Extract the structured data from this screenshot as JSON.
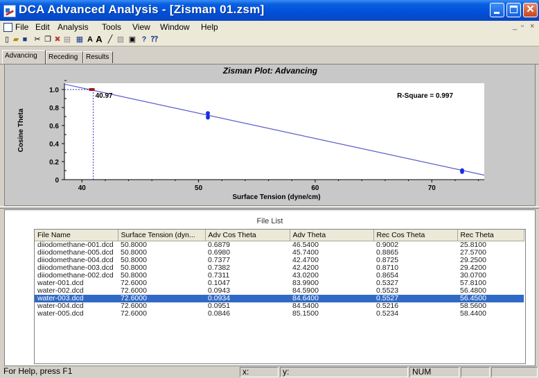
{
  "window": {
    "title": "DCA Advanced Analysis - [Zisman 01.zsm]"
  },
  "menu": [
    "File",
    "Edit",
    "Analysis",
    "Tools",
    "View",
    "Window",
    "Help"
  ],
  "tabs": [
    "Advancing",
    "Receding",
    "Results"
  ],
  "active_tab": "Advancing",
  "chart_data": {
    "type": "scatter",
    "title": "Zisman Plot: Advancing",
    "xlabel": "Surface Tension (dyne/cm)",
    "ylabel": "Cosine Theta",
    "xlim": [
      38.5,
      74.5
    ],
    "ylim": [
      0,
      1.07
    ],
    "xticks": [
      40,
      50,
      60,
      70
    ],
    "yticks": [
      0,
      0.2,
      0.4,
      0.6,
      0.8,
      1.0
    ],
    "ytick_labels": [
      "0",
      "0.2",
      "0.4",
      "0.6",
      "0.8",
      "1.0"
    ],
    "points": [
      {
        "x": 50.8,
        "y": 0.6879
      },
      {
        "x": 50.8,
        "y": 0.698
      },
      {
        "x": 50.8,
        "y": 0.7377
      },
      {
        "x": 50.8,
        "y": 0.7382
      },
      {
        "x": 50.8,
        "y": 0.7311
      },
      {
        "x": 72.6,
        "y": 0.1047
      },
      {
        "x": 72.6,
        "y": 0.0943
      },
      {
        "x": 72.6,
        "y": 0.0934
      },
      {
        "x": 72.6,
        "y": 0.0951
      },
      {
        "x": 72.6,
        "y": 0.0846
      }
    ],
    "fit_line": {
      "x": [
        38.5,
        74.5
      ],
      "y": [
        1.06,
        0.05
      ]
    },
    "critical_point": {
      "x": 40.97,
      "y": 1.0,
      "label": "40.97"
    },
    "annotation": "R-Square = 0.997",
    "colors": {
      "points": "#1c2ee6",
      "line": "#5b5bc8",
      "marker": "#9e1212",
      "guide": "#2828c8"
    },
    "grid": false
  },
  "filelist": {
    "title": "File List",
    "columns": [
      "File Name",
      "Surface Tension (dyn...",
      "Adv Cos Theta",
      "Adv Theta",
      "Rec Cos Theta",
      "Rec Theta"
    ],
    "rows": [
      [
        "diiodomethane-001.dcd",
        "50.8000",
        "0.6879",
        "46.5400",
        "0.9002",
        "25.8100"
      ],
      [
        "diiodomethane-005.dcd",
        "50.8000",
        "0.6980",
        "45.7400",
        "0.8865",
        "27.5700"
      ],
      [
        "diiodomethane-004.dcd",
        "50.8000",
        "0.7377",
        "42.4700",
        "0.8725",
        "29.2500"
      ],
      [
        "diiodomethane-003.dcd",
        "50.8000",
        "0.7382",
        "42.4200",
        "0.8710",
        "29.4200"
      ],
      [
        "diiodomethane-002.dcd",
        "50.8000",
        "0.7311",
        "43.0200",
        "0.8654",
        "30.0700"
      ],
      [
        "water-001.dcd",
        "72.6000",
        "0.1047",
        "83.9900",
        "0.5327",
        "57.8100"
      ],
      [
        "water-002.dcd",
        "72.6000",
        "0.0943",
        "84.5900",
        "0.5523",
        "56.4800"
      ],
      [
        "water-003.dcd",
        "72.6000",
        "0.0934",
        "84.6400",
        "0.5527",
        "56.4500"
      ],
      [
        "water-004.dcd",
        "72.6000",
        "0.0951",
        "84.5400",
        "0.5216",
        "58.5600"
      ],
      [
        "water-005.dcd",
        "72.6000",
        "0.0846",
        "85.1500",
        "0.5234",
        "58.4400"
      ]
    ],
    "selected_row": 7
  },
  "status": {
    "help": "For Help, press F1",
    "x": "x:",
    "y": "y:",
    "num": "NUM"
  },
  "toolbar_icons": [
    "new-icon",
    "open-icon",
    "save-icon",
    "cut-icon",
    "copy-icon",
    "delete-icon",
    "paste-icon",
    "table-icon",
    "font-a-icon",
    "font-a-large-icon",
    "line-icon",
    "image-icon",
    "print-icon",
    "help-icon",
    "context-help-icon"
  ]
}
